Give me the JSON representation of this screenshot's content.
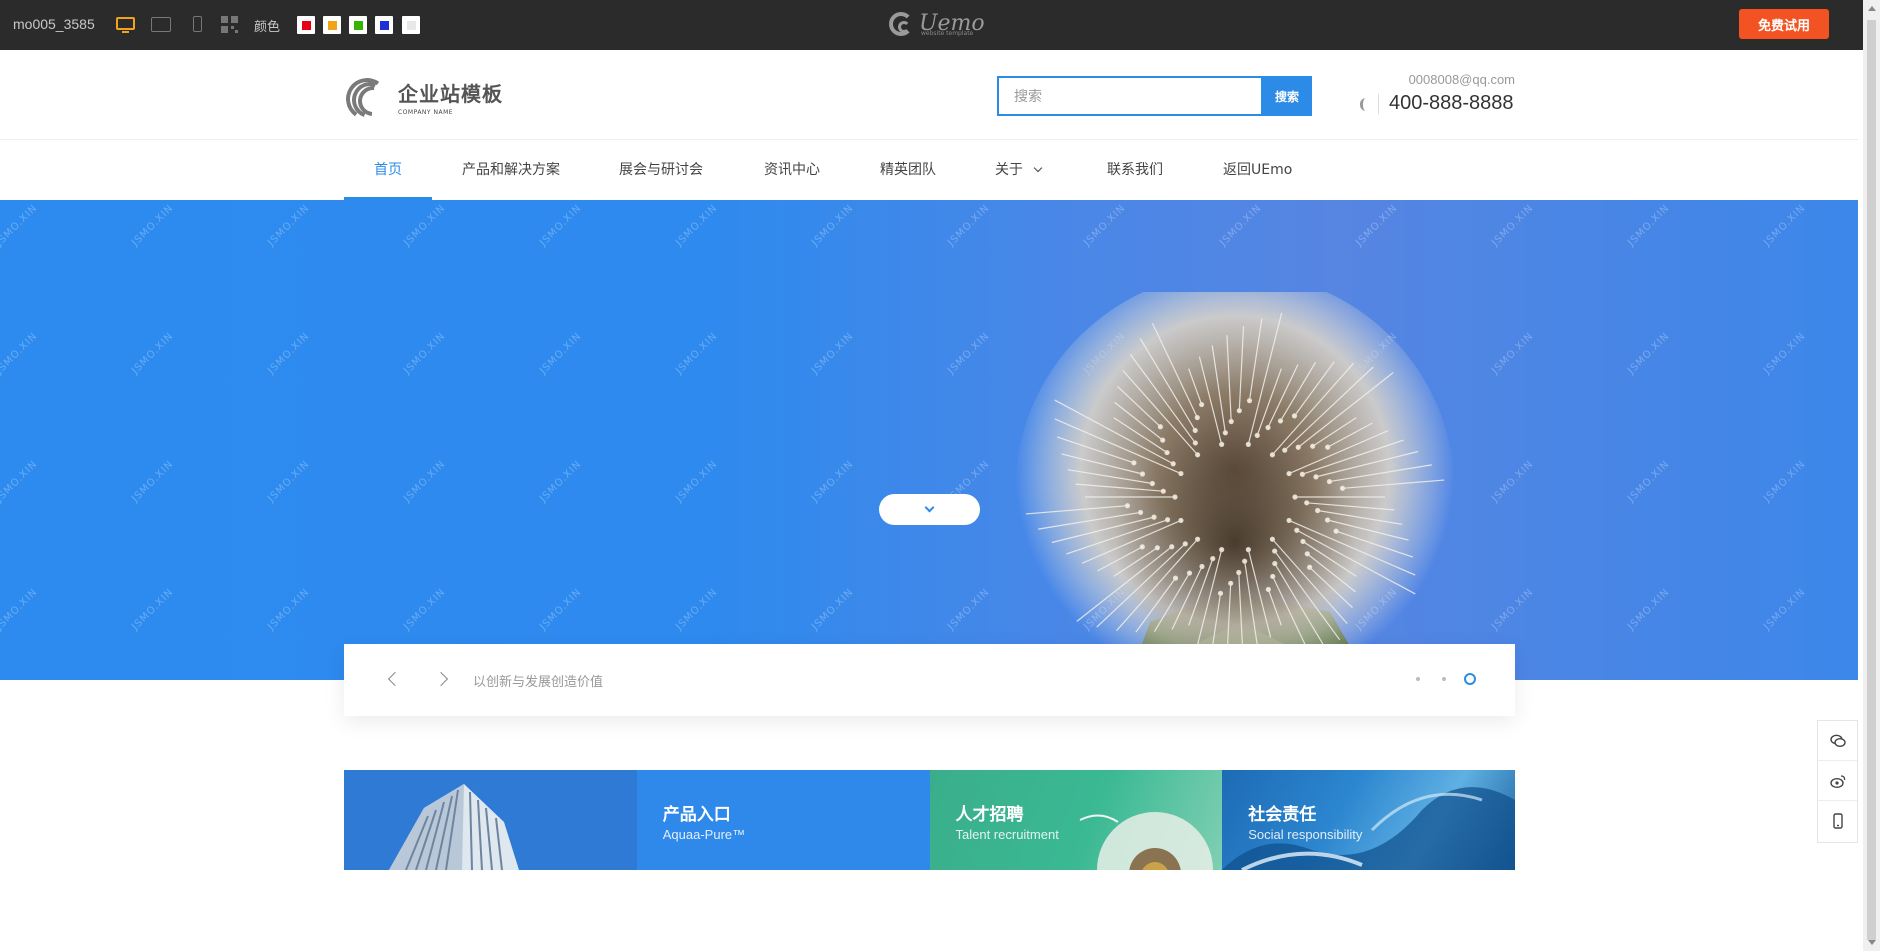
{
  "toolbar": {
    "template_code": "mo005_3585",
    "color_label": "颜色",
    "devices": [
      "desktop-icon",
      "tablet-icon",
      "phone-icon",
      "qrcode-icon"
    ],
    "swatches": [
      "#e60012",
      "#f2a318",
      "#35b400",
      "#1d2fd8",
      "#e8e8e8"
    ],
    "brand_logo_text": "Uemo",
    "brand_logo_sub": "website template",
    "trial_button": "免费试用"
  },
  "header": {
    "logo_cn": "企业站模板",
    "logo_en": "COMPANY NAME",
    "search_placeholder": "搜索",
    "search_button": "搜索",
    "email": "0008008@qq.com",
    "phone": "400-888-8888"
  },
  "nav": {
    "items": [
      "首页",
      "产品和解决方案",
      "展会与研讨会",
      "资讯中心",
      "精英团队",
      "关于",
      "联系我们",
      "返回UEmo"
    ],
    "active_index": 0
  },
  "hero": {
    "watermark": "JSMO.XIN",
    "caption": "以创新与发展创造价值",
    "slide_count": 3,
    "active_slide": 3
  },
  "tiles": [
    {
      "title": "",
      "subtitle": ""
    },
    {
      "title": "产品入口",
      "subtitle": "Aquaa-Pure™"
    },
    {
      "title": "人才招聘",
      "subtitle": "Talent recruitment"
    },
    {
      "title": "社会责任",
      "subtitle": "Social responsibility"
    }
  ],
  "float_bar": [
    "chat-icon",
    "weibo-icon",
    "mobile-icon"
  ],
  "colors": {
    "accent": "#2d8be8",
    "trial_button": "#f35322",
    "toolbar_bg": "#2b2b2b"
  }
}
